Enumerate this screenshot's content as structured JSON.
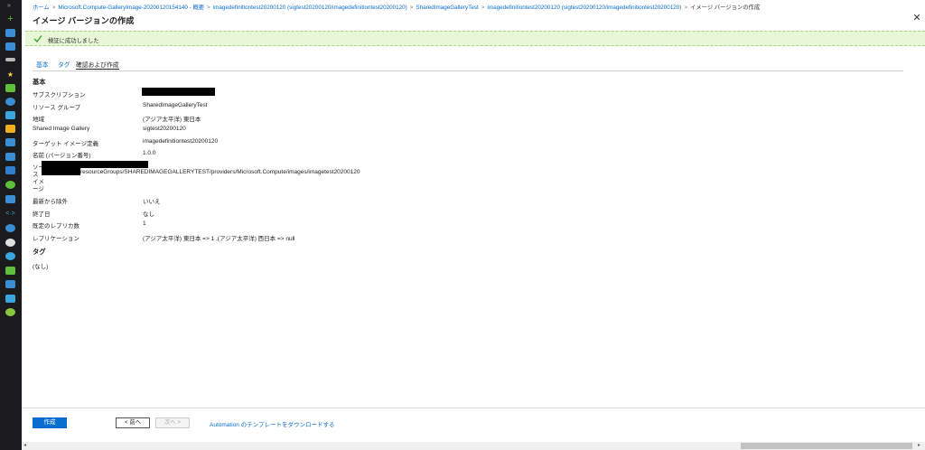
{
  "breadcrumb": {
    "items": [
      "ホーム",
      "Microsoft.Compute-GalleryImage-20200120154140 - 概要",
      "imagedefinitiontest20200120 (sigtest20200120/imagedefinitiontest20200120)",
      "SharedImageGalleryTest",
      "imagedefinitiontest20200120 (sigtest20200120/imagedefinitiontest20200120)",
      "イメージ バージョンの作成"
    ]
  },
  "page": {
    "title": "イメージ バージョンの作成"
  },
  "banner": {
    "message": "検証に成功しました"
  },
  "tabs": [
    {
      "label": "基本"
    },
    {
      "label": "タグ"
    },
    {
      "label": "確認および作成"
    }
  ],
  "basics": {
    "heading": "基本",
    "rows": [
      {
        "label": "サブスクリプション",
        "value": ""
      },
      {
        "label": "リソース グループ",
        "value": "SharedImageGalleryTest"
      },
      {
        "label": "地域",
        "value": "(アジア太平洋) 東日本"
      },
      {
        "label": "Shared Image Gallery",
        "value": "sigtest20200120"
      },
      {
        "label": "ターゲット イメージ定義",
        "value": "imagedefinitiontest20200120"
      },
      {
        "label": "名前 (バージョン番号)",
        "value": "1.0.0"
      }
    ],
    "source_label_lines": [
      "ソー",
      "ス",
      "イメ",
      "ージ"
    ],
    "source_value": "resourceGroups/SHAREDIMAGEGALLERYTEST/providers/Microsoft.Compute/images/imagetest20200120",
    "rows2": [
      {
        "label": "最新から除外",
        "value": "いいえ"
      },
      {
        "label": "終了日",
        "value": "なし"
      },
      {
        "label": "既定のレプリカ数",
        "value": "1"
      },
      {
        "label": "レプリケーション",
        "value": "(アジア太平洋) 東日本 => 1 ,(アジア太平洋) 西日本 => null"
      }
    ]
  },
  "tags": {
    "heading": "タグ",
    "value": "(なし)"
  },
  "footer": {
    "create_label": "作成",
    "prev_label": "< 前へ",
    "next_label": "次へ >",
    "download_link": "Automation のテンプレートをダウンロードする"
  },
  "colors": {
    "accent": "#0a6ed1",
    "banner_bg": "#e7f7d7",
    "rail_bg": "#1b1b1d"
  }
}
